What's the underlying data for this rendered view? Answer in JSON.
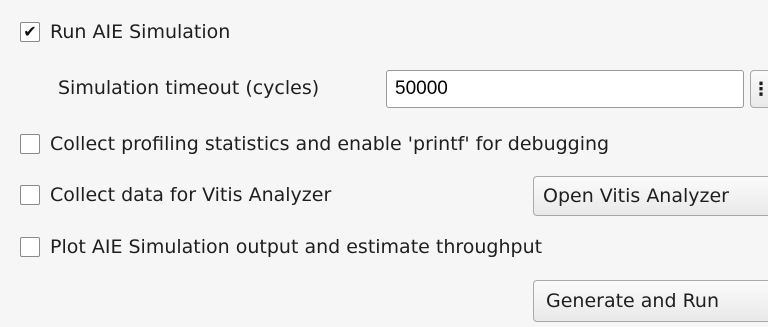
{
  "run_sim": {
    "checked": true,
    "check_glyph": "✔",
    "label": "Run AIE Simulation"
  },
  "timeout": {
    "label": "Simulation timeout (cycles)",
    "value": "50000",
    "more_glyph": "⋮"
  },
  "profiling": {
    "checked": false,
    "label": "Collect profiling statistics and enable 'printf' for debugging"
  },
  "vitis": {
    "checked": false,
    "label": "Collect data for Vitis Analyzer",
    "button_label": "Open Vitis Analyzer"
  },
  "plot": {
    "checked": false,
    "label": "Plot AIE Simulation output and estimate throughput"
  },
  "generate_button_label": "Generate and Run"
}
